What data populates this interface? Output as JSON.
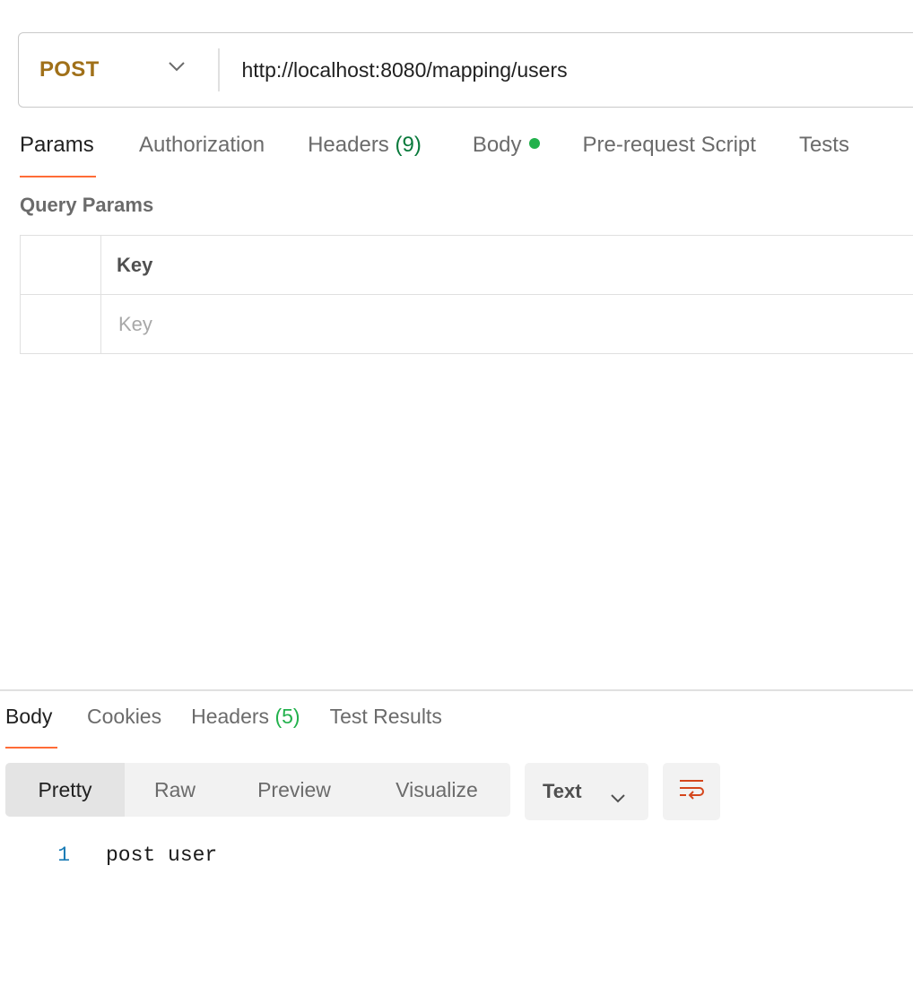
{
  "request": {
    "method": "POST",
    "url": "http://localhost:8080/mapping/users"
  },
  "request_tabs": [
    {
      "label": "Params"
    },
    {
      "label": "Authorization"
    },
    {
      "label": "Headers",
      "count": "(9)"
    },
    {
      "label": "Body"
    },
    {
      "label": "Pre-request Script"
    },
    {
      "label": "Tests"
    }
  ],
  "query_params": {
    "title": "Query Params",
    "column_key": "Key",
    "key_placeholder": "Key"
  },
  "response_tabs": [
    {
      "label": "Body"
    },
    {
      "label": "Cookies"
    },
    {
      "label": "Headers",
      "count": "(5)"
    },
    {
      "label": "Test Results"
    }
  ],
  "format_options": [
    "Pretty",
    "Raw",
    "Preview",
    "Visualize"
  ],
  "response_type": "Text",
  "response_body": {
    "line_number": "1",
    "text": "post user"
  },
  "colors": {
    "method": "#a07019",
    "active_tab_underline": "#ff6c37",
    "body_indicator": "#22b14c",
    "wrap_icon": "#d5461c"
  }
}
